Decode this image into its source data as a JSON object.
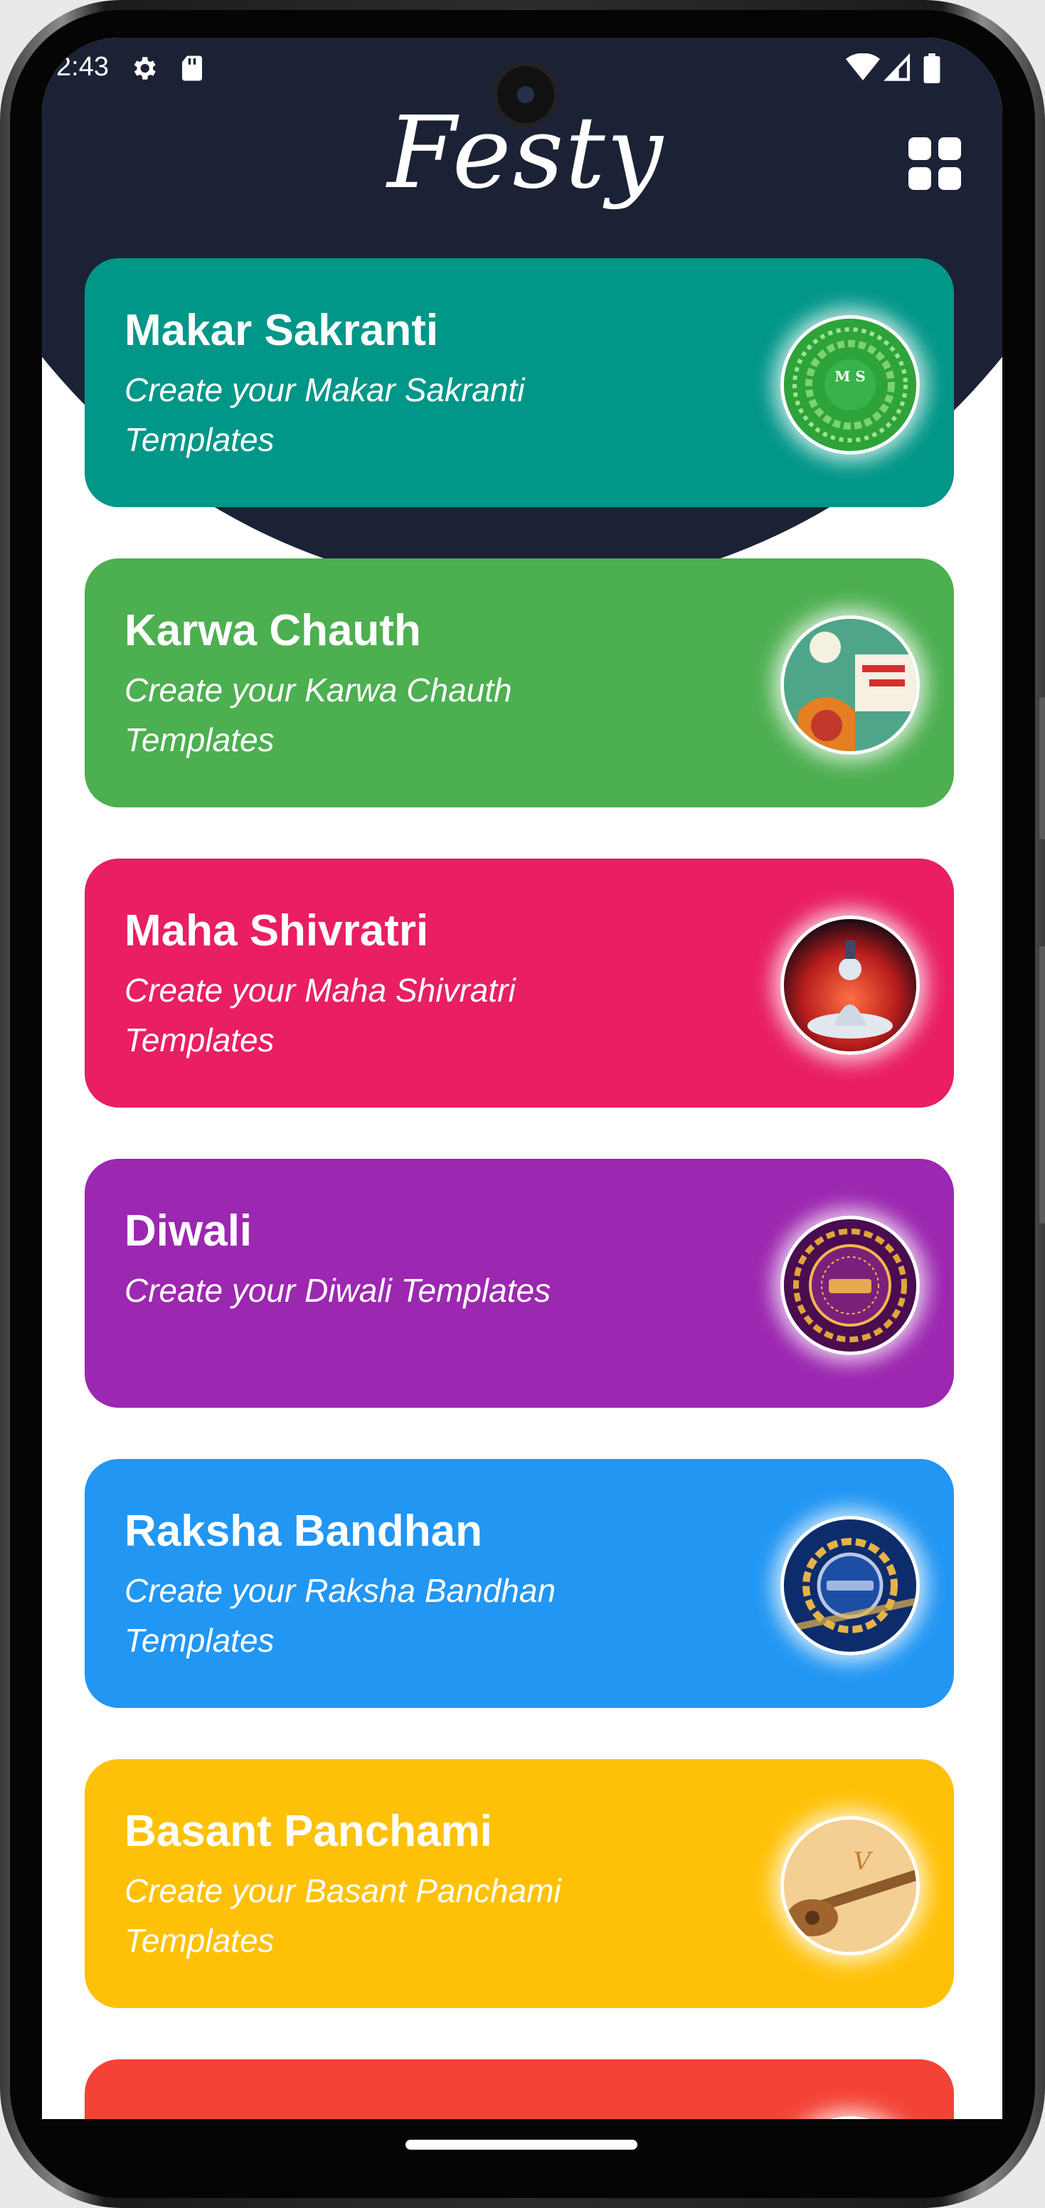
{
  "status_bar": {
    "time": "2:43"
  },
  "app": {
    "logo": "Festy"
  },
  "cards": [
    {
      "title": "Makar Sakranti",
      "subtitle": "Create your Makar Sakranti Templates",
      "color": "#009688"
    },
    {
      "title": "Karwa Chauth",
      "subtitle": "Create your Karwa Chauth Templates",
      "color": "#4caf50"
    },
    {
      "title": "Maha Shivratri",
      "subtitle": "Create your Maha Shivratri Templates",
      "color": "#e91e63"
    },
    {
      "title": "Diwali",
      "subtitle": "Create your Diwali Templates",
      "color": "#9c27b0"
    },
    {
      "title": "Raksha Bandhan",
      "subtitle": "Create your Raksha Bandhan Templates",
      "color": "#2196f3"
    },
    {
      "title": "Basant Panchami",
      "subtitle": "Create your Basant Panchami Templates",
      "color": "#ffc107"
    },
    {
      "title": "",
      "subtitle": "",
      "color": "#f44336"
    }
  ],
  "icons": {
    "settings": "settings-icon",
    "sd_card": "sd-card-icon",
    "wifi": "wifi-icon",
    "signal": "signal-icon",
    "battery": "battery-icon",
    "grid": "grid-menu-icon"
  },
  "theme": {
    "header": "#1c2236",
    "background": "#ffffff"
  }
}
